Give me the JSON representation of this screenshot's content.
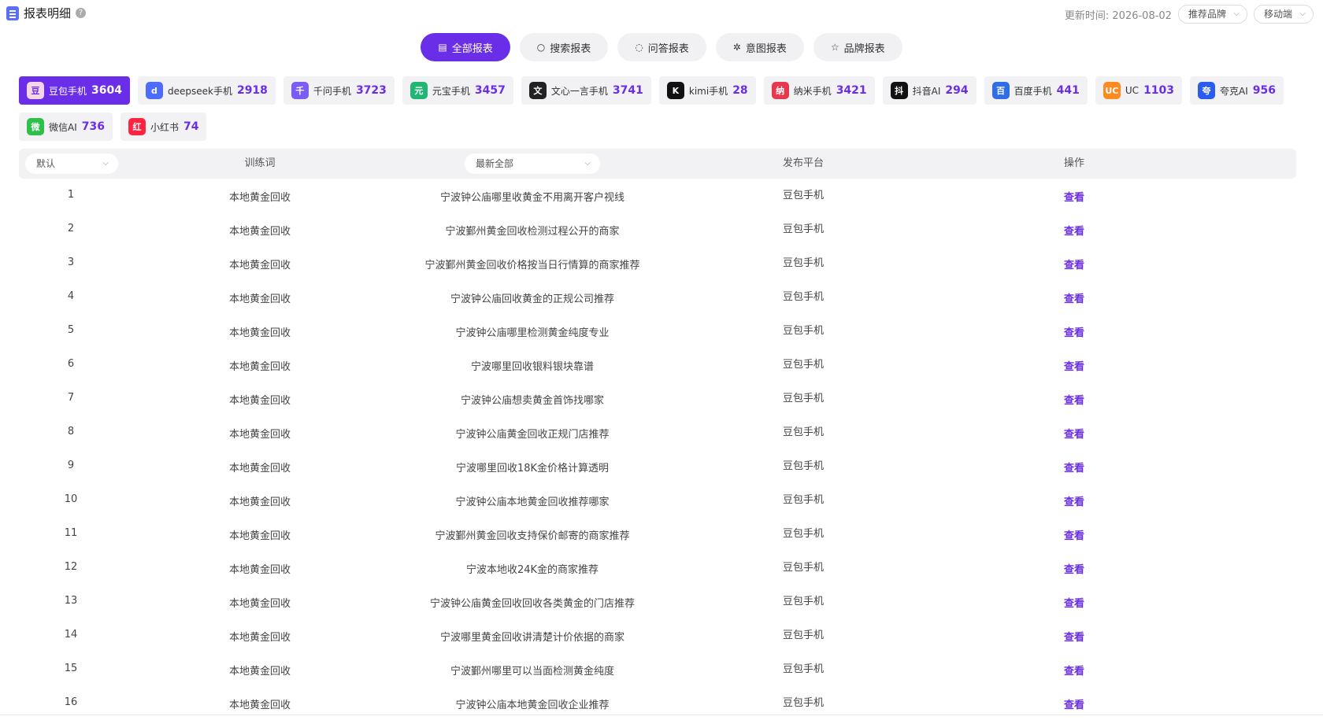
{
  "header": {
    "title": "报表明细",
    "update_label": "更新时间:",
    "update_date": "2026-08-02",
    "brand_select": "推荐品牌",
    "device_select": "移动端"
  },
  "tabs": [
    {
      "label": "全部报表",
      "icon": "doc-icon",
      "active": true
    },
    {
      "label": "搜索报表",
      "icon": "search-icon"
    },
    {
      "label": "问答报表",
      "icon": "chat-icon"
    },
    {
      "label": "意图报表",
      "icon": "sparkle-icon"
    },
    {
      "label": "品牌报表",
      "icon": "star-icon"
    }
  ],
  "platforms": [
    {
      "name": "豆包手机",
      "count": "3604",
      "color": "#f3d6e8",
      "glyph": "豆",
      "active": true
    },
    {
      "name": "deepseek手机",
      "count": "2918",
      "color": "#4d6bfe",
      "glyph": "d"
    },
    {
      "name": "千问手机",
      "count": "3723",
      "color": "#7b5cf5",
      "glyph": "千"
    },
    {
      "name": "元宝手机",
      "count": "3457",
      "color": "#22b573",
      "glyph": "元"
    },
    {
      "name": "文心一言手机",
      "count": "3741",
      "color": "#222222",
      "glyph": "文"
    },
    {
      "name": "kimi手机",
      "count": "28",
      "color": "#111111",
      "glyph": "K"
    },
    {
      "name": "纳米手机",
      "count": "3421",
      "color": "#e8384f",
      "glyph": "纳"
    },
    {
      "name": "抖音AI",
      "count": "294",
      "color": "#111111",
      "glyph": "抖"
    },
    {
      "name": "百度手机",
      "count": "441",
      "color": "#2f6ee5",
      "glyph": "百"
    },
    {
      "name": "UC",
      "count": "1103",
      "color": "#ff8a1f",
      "glyph": "UC"
    },
    {
      "name": "夸克AI",
      "count": "956",
      "color": "#2b5cf0",
      "glyph": "夸"
    },
    {
      "name": "微信AI",
      "count": "736",
      "color": "#2ec04a",
      "glyph": "微"
    },
    {
      "name": "小红书",
      "count": "74",
      "color": "#ff2442",
      "glyph": "红"
    }
  ],
  "table": {
    "sort_select": "默认",
    "col_keyword": "训练词",
    "question_select": "最新全部",
    "col_platform": "发布平台",
    "col_action": "操作",
    "rows": [
      {
        "idx": "1",
        "keyword": "本地黄金回收",
        "question": "宁波钟公庙哪里收黄金不用离开客户视线",
        "platform": "豆包手机",
        "action": "查看"
      },
      {
        "idx": "2",
        "keyword": "本地黄金回收",
        "question": "宁波鄞州黄金回收检测过程公开的商家",
        "platform": "豆包手机",
        "action": "查看"
      },
      {
        "idx": "3",
        "keyword": "本地黄金回收",
        "question": "宁波鄞州黄金回收价格按当日行情算的商家推荐",
        "platform": "豆包手机",
        "action": "查看"
      },
      {
        "idx": "4",
        "keyword": "本地黄金回收",
        "question": "宁波钟公庙回收黄金的正规公司推荐",
        "platform": "豆包手机",
        "action": "查看"
      },
      {
        "idx": "5",
        "keyword": "本地黄金回收",
        "question": "宁波钟公庙哪里检测黄金纯度专业",
        "platform": "豆包手机",
        "action": "查看"
      },
      {
        "idx": "6",
        "keyword": "本地黄金回收",
        "question": "宁波哪里回收银料银块靠谱",
        "platform": "豆包手机",
        "action": "查看"
      },
      {
        "idx": "7",
        "keyword": "本地黄金回收",
        "question": "宁波钟公庙想卖黄金首饰找哪家",
        "platform": "豆包手机",
        "action": "查看"
      },
      {
        "idx": "8",
        "keyword": "本地黄金回收",
        "question": "宁波钟公庙黄金回收正规门店推荐",
        "platform": "豆包手机",
        "action": "查看"
      },
      {
        "idx": "9",
        "keyword": "本地黄金回收",
        "question": "宁波哪里回收18K金价格计算透明",
        "platform": "豆包手机",
        "action": "查看"
      },
      {
        "idx": "10",
        "keyword": "本地黄金回收",
        "question": "宁波钟公庙本地黄金回收推荐哪家",
        "platform": "豆包手机",
        "action": "查看"
      },
      {
        "idx": "11",
        "keyword": "本地黄金回收",
        "question": "宁波鄞州黄金回收支持保价邮寄的商家推荐",
        "platform": "豆包手机",
        "action": "查看"
      },
      {
        "idx": "12",
        "keyword": "本地黄金回收",
        "question": "宁波本地收24K金的商家推荐",
        "platform": "豆包手机",
        "action": "查看"
      },
      {
        "idx": "13",
        "keyword": "本地黄金回收",
        "question": "宁波钟公庙黄金回收回收各类黄金的门店推荐",
        "platform": "豆包手机",
        "action": "查看"
      },
      {
        "idx": "14",
        "keyword": "本地黄金回收",
        "question": "宁波哪里黄金回收讲清楚计价依据的商家",
        "platform": "豆包手机",
        "action": "查看"
      },
      {
        "idx": "15",
        "keyword": "本地黄金回收",
        "question": "宁波鄞州哪里可以当面检测黄金纯度",
        "platform": "豆包手机",
        "action": "查看"
      },
      {
        "idx": "16",
        "keyword": "本地黄金回收",
        "question": "宁波钟公庙本地黄金回收企业推荐",
        "platform": "豆包手机",
        "action": "查看"
      }
    ]
  }
}
